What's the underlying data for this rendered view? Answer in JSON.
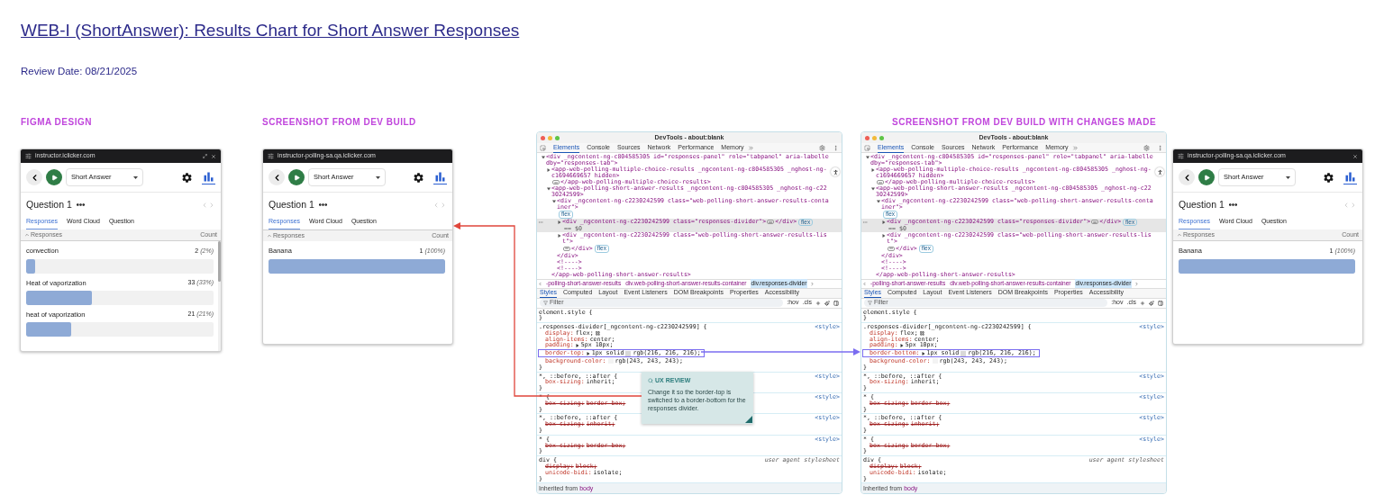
{
  "title": "WEB-I (ShortAnswer): Results Chart for Short Answer Responses",
  "review_date": "Review Date: 08/21/2025",
  "section_headings": [
    "FIGMA DESIGN",
    "SCREENSHOT FROM DEV BUILD",
    "SCREENSHOT FROM DEV BUILD WITH CHANGES MADE"
  ],
  "app_panels": [
    {
      "url": "instructor.iclicker.com",
      "controls": [
        {
          "kind": "expand"
        },
        {
          "kind": "close"
        }
      ],
      "dropdown": "Short Answer",
      "question": "Question 1",
      "tabs": [
        {
          "label": "Responses",
          "selected": true
        },
        {
          "label": "Word Cloud",
          "selected": false
        },
        {
          "label": "Question",
          "selected": false
        }
      ],
      "header_left": "Responses",
      "header_right": "Count",
      "divider_below": true,
      "scrollable": true,
      "responses": [
        {
          "label": "convection",
          "count": "2",
          "percent": "(2%)",
          "level": 0.05
        },
        {
          "label": "Heat of vaporization",
          "count": "33",
          "percent": "(33%)",
          "level": 0.35
        },
        {
          "label": "heat of vaporization",
          "count": "21",
          "percent": "(21%)",
          "level": 0.24
        }
      ]
    },
    {
      "url": "instructor-polling-sa.qa.iclicker.com",
      "dropdown": "Short Answer",
      "question": "Question 1",
      "tabs": [
        {
          "label": "Responses",
          "selected": true
        },
        {
          "label": "Word Cloud",
          "selected": false
        },
        {
          "label": "Question",
          "selected": false
        }
      ],
      "header_left": "Responses",
      "header_right": "Count",
      "divider_below": false,
      "scrollable": false,
      "responses": [
        {
          "label": "Banana",
          "count": "1",
          "percent": "(100%)",
          "level": 1
        }
      ]
    },
    {
      "url": "instructor-polling-sa.qa.iclicker.com",
      "controls": [
        {
          "kind": "close"
        }
      ],
      "dropdown": "Short Answer",
      "question": "Question 1",
      "tabs": [
        {
          "label": "Responses",
          "selected": true
        },
        {
          "label": "Word Cloud",
          "selected": false
        },
        {
          "label": "Question",
          "selected": false
        }
      ],
      "header_left": "Responses",
      "header_right": "Count",
      "divider_below": true,
      "scrollable": false,
      "responses": [
        {
          "label": "Banana",
          "count": "1",
          "percent": "(100%)",
          "level": 1
        }
      ]
    }
  ],
  "devtools": [
    {
      "title": "DevTools - about:blank",
      "tabs": [
        {
          "label": "Elements",
          "selected": true
        },
        {
          "label": "Console",
          "selected": false
        },
        {
          "label": "Sources",
          "selected": false
        },
        {
          "label": "Network",
          "selected": false
        },
        {
          "label": "Performance",
          "selected": false
        },
        {
          "label": "Memory",
          "selected": false
        }
      ],
      "dom": [
        {
          "text": "<div _ngcontent-ng-c804585305 id=\"responses-panel\" role=\"tabpanel\" aria-labelledby=\"responses-tab\">",
          "expanded": true,
          "selected": false,
          "children": [
            {
              "text": "<app-web-polling-multiple-choice-results _ngcontent-ng-c804585305 _nghost-ng-c1694669657 hidden>",
              "expanded": false,
              "selected": false,
              "close": "</app-web-polling-multiple-choice-results>"
            },
            {
              "text": "<app-web-polling-short-answer-results _ngcontent-ng-c804585305 _nghost-ng-c2230242599>",
              "expanded": true,
              "selected": false,
              "close": "</app-web-polling-short-answer-results>",
              "children": [
                {
                  "text": "<div _ngcontent-ng-c2230242599 class=\"web-polling-short-answer-results-container\">",
                  "badge": "flex",
                  "expanded": true,
                  "selected": false,
                  "close": "</div>",
                  "children": [
                    {
                      "text": "<div _ngcontent-ng-c2230242599 class=\"responses-divider\">",
                      "close": "</div>",
                      "badge": "flex",
                      "suffix": "== $0",
                      "expanded": false,
                      "selected": true
                    },
                    {
                      "text": "<div _ngcontent-ng-c2230242599 class=\"web-polling-short-answer-results-list\">",
                      "close": "</div>",
                      "badge": "flex",
                      "expanded": false,
                      "selected": false
                    }
                  ]
                },
                {
                  "text": "<!---->",
                  "selected": false
                },
                {
                  "text": "<!---->",
                  "selected": false
                }
              ]
            }
          ]
        }
      ],
      "breadcrumbs": [
        {
          "label": "-polling-short-answer-results",
          "selected": false
        },
        {
          "label": "div.web-polling-short-answer-results-container",
          "selected": false
        },
        {
          "label": "div.responses-divider",
          "selected": true
        }
      ],
      "style_tabs": [
        {
          "label": "Styles",
          "selected": true
        },
        {
          "label": "Computed",
          "selected": false
        },
        {
          "label": "Layout",
          "selected": false
        },
        {
          "label": "Event Listeners",
          "selected": false
        },
        {
          "label": "DOM Breakpoints",
          "selected": false
        },
        {
          "label": "Properties",
          "selected": false
        },
        {
          "label": "Accessibility",
          "selected": false
        }
      ],
      "filter": {
        "placeholder": "Filter"
      },
      "filter_tools": [
        ":hov",
        ".cls"
      ],
      "rules": [
        {
          "selector": "element.style {",
          "close": "}"
        },
        {
          "selector": ".responses-divider[_ngcontent-ng-c2230242599] {",
          "source": "<style>",
          "close": "}",
          "props": [
            {
              "name": "display:",
              "value": "flex;",
              "editor": true,
              "struck": false,
              "highlighted": false
            },
            {
              "name": "align-items:",
              "value": "center;",
              "struck": false,
              "highlighted": false
            },
            {
              "name": "padding:",
              "expandable": true,
              "value": "5px 10px;",
              "struck": false,
              "highlighted": false
            },
            {
              "name": "border-top:",
              "expandable": true,
              "value": "1px solid",
              "color": "#d8d8d8",
              "color_value": "rgb(216, 216, 216);",
              "struck": false,
              "highlighted": true
            },
            {
              "name": "background-color:",
              "color": "#f3f3f3",
              "color_value": "rgb(243, 243, 243);",
              "struck": false,
              "highlighted": false
            }
          ]
        },
        {
          "selector": "*, ::before, ::after {",
          "source": "<style>",
          "close": "}",
          "props": [
            {
              "name": "box-sizing:",
              "value": "inherit;",
              "struck": false,
              "highlighted": false
            }
          ]
        },
        {
          "selector": "* {",
          "source": "<style>",
          "close": "}",
          "props": [
            {
              "name": "box-sizing:",
              "value": "border-box;",
              "struck": true,
              "highlighted": false
            }
          ]
        },
        {
          "selector": "*, ::before, ::after {",
          "source": "<style>",
          "close": "}",
          "props": [
            {
              "name": "box-sizing:",
              "value": "inherit;",
              "struck": true,
              "highlighted": false
            }
          ]
        },
        {
          "selector": "* {",
          "source": "<style>",
          "close": "}",
          "props": [
            {
              "name": "box-sizing:",
              "value": "border-box;",
              "struck": true,
              "highlighted": false
            }
          ]
        },
        {
          "selector": "div {",
          "source": "user agent stylesheet",
          "close": "}",
          "props": [
            {
              "name": "display:",
              "value": "block;",
              "struck": true,
              "highlighted": false
            },
            {
              "name": "unicode-bidi:",
              "value": "isolate;",
              "struck": false,
              "highlighted": false
            }
          ]
        }
      ],
      "inherited": {
        "label": "Inherited from",
        "element": "body"
      }
    },
    {
      "title": "DevTools - about:blank",
      "tabs": [
        {
          "label": "Elements",
          "selected": true
        },
        {
          "label": "Console",
          "selected": false
        },
        {
          "label": "Sources",
          "selected": false
        },
        {
          "label": "Network",
          "selected": false
        },
        {
          "label": "Performance",
          "selected": false
        },
        {
          "label": "Memory",
          "selected": false
        }
      ],
      "dom": [
        {
          "text": "<div _ngcontent-ng-c804585305 id=\"responses-panel\" role=\"tabpanel\" aria-labelledby=\"responses-tab\">",
          "expanded": true,
          "selected": false,
          "children": [
            {
              "text": "<app-web-polling-multiple-choice-results _ngcontent-ng-c804585305 _nghost-ng-c1694669657 hidden>",
              "expanded": false,
              "selected": false,
              "close": "</app-web-polling-multiple-choice-results>"
            },
            {
              "text": "<app-web-polling-short-answer-results _ngcontent-ng-c804585305 _nghost-ng-c2230242599>",
              "expanded": true,
              "selected": false,
              "close": "</app-web-polling-short-answer-results>",
              "children": [
                {
                  "text": "<div _ngcontent-ng-c2230242599 class=\"web-polling-short-answer-results-container\">",
                  "badge": "flex",
                  "expanded": true,
                  "selected": false,
                  "close": "</div>",
                  "children": [
                    {
                      "text": "<div _ngcontent-ng-c2230242599 class=\"responses-divider\">",
                      "close": "</div>",
                      "badge": "flex",
                      "suffix": "== $0",
                      "expanded": false,
                      "selected": true
                    },
                    {
                      "text": "<div _ngcontent-ng-c2230242599 class=\"web-polling-short-answer-results-list\">",
                      "close": "</div>",
                      "badge": "flex",
                      "expanded": false,
                      "selected": false
                    }
                  ]
                },
                {
                  "text": "<!---->",
                  "selected": false
                },
                {
                  "text": "<!---->",
                  "selected": false
                }
              ]
            }
          ]
        }
      ],
      "breadcrumbs": [
        {
          "label": "-polling-short-answer-results",
          "selected": false
        },
        {
          "label": "div.web-polling-short-answer-results-container",
          "selected": false
        },
        {
          "label": "div.responses-divider",
          "selected": true
        }
      ],
      "style_tabs": [
        {
          "label": "Styles",
          "selected": true
        },
        {
          "label": "Computed",
          "selected": false
        },
        {
          "label": "Layout",
          "selected": false
        },
        {
          "label": "Event Listeners",
          "selected": false
        },
        {
          "label": "DOM Breakpoints",
          "selected": false
        },
        {
          "label": "Properties",
          "selected": false
        },
        {
          "label": "Accessibility",
          "selected": false
        }
      ],
      "filter": {
        "placeholder": "Filter"
      },
      "filter_tools": [
        ":hov",
        ".cls"
      ],
      "rules": [
        {
          "selector": "element.style {",
          "close": "}"
        },
        {
          "selector": ".responses-divider[_ngcontent-ng-c2230242599] {",
          "source": "<style>",
          "close": "}",
          "props": [
            {
              "name": "display:",
              "value": "flex;",
              "editor": true,
              "struck": false,
              "highlighted": false
            },
            {
              "name": "align-items:",
              "value": "center;",
              "struck": false,
              "highlighted": false
            },
            {
              "name": "padding:",
              "expandable": true,
              "value": "5px 10px;",
              "struck": false,
              "highlighted": false
            },
            {
              "name": "border-bottom:",
              "expandable": true,
              "value": "1px solid",
              "color": "#d8d8d8",
              "color_value": "rgb(216, 216, 216);",
              "struck": false,
              "highlighted": true
            },
            {
              "name": "background-color:",
              "color": "#f3f3f3",
              "color_value": "rgb(243, 243, 243);",
              "struck": false,
              "highlighted": false
            }
          ]
        },
        {
          "selector": "*, ::before, ::after {",
          "source": "<style>",
          "close": "}",
          "props": [
            {
              "name": "box-sizing:",
              "value": "inherit;",
              "struck": false,
              "highlighted": false
            }
          ]
        },
        {
          "selector": "* {",
          "source": "<style>",
          "close": "}",
          "props": [
            {
              "name": "box-sizing:",
              "value": "border-box;",
              "struck": true,
              "highlighted": false
            }
          ]
        },
        {
          "selector": "*, ::before, ::after {",
          "source": "<style>",
          "close": "}",
          "props": [
            {
              "name": "box-sizing:",
              "value": "inherit;",
              "struck": true,
              "highlighted": false
            }
          ]
        },
        {
          "selector": "* {",
          "source": "<style>",
          "close": "}",
          "props": [
            {
              "name": "box-sizing:",
              "value": "border-box;",
              "struck": true,
              "highlighted": false
            }
          ]
        },
        {
          "selector": "div {",
          "source": "user agent stylesheet",
          "close": "}",
          "props": [
            {
              "name": "display:",
              "value": "block;",
              "struck": true,
              "highlighted": false
            },
            {
              "name": "unicode-bidi:",
              "value": "isolate;",
              "struck": false,
              "highlighted": false
            }
          ]
        }
      ],
      "inherited": {
        "label": "Inherited from",
        "element": "body"
      }
    }
  ],
  "note": {
    "label": "UX REVIEW",
    "text": "Change it so the border-top is switched to a border-bottom for the responses divider."
  }
}
